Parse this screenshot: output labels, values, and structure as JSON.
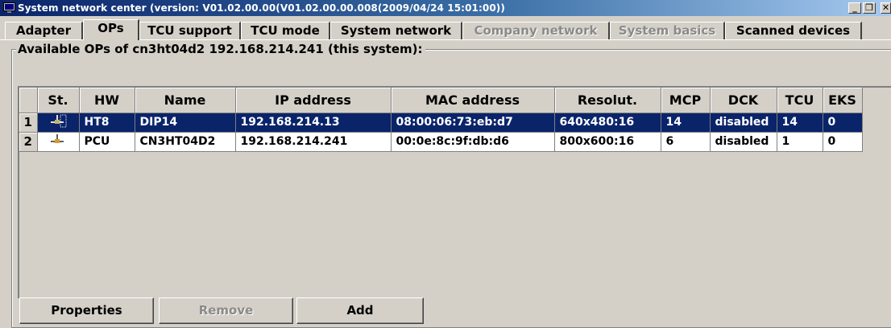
{
  "window": {
    "title": "System network center (version: V01.02.00.00(V01.02.00.00.008(2009/04/24 15:01:00))",
    "minimize_label": "_",
    "restore_label": "❒",
    "close_label": "✕"
  },
  "tabs": [
    {
      "label": "Adapter",
      "state": "normal"
    },
    {
      "label": "OPs",
      "state": "active"
    },
    {
      "label": "TCU support",
      "state": "normal"
    },
    {
      "label": "TCU mode",
      "state": "normal"
    },
    {
      "label": "System network",
      "state": "normal"
    },
    {
      "label": "Company network",
      "state": "disabled"
    },
    {
      "label": "System basics",
      "state": "disabled"
    },
    {
      "label": "Scanned devices",
      "state": "normal"
    }
  ],
  "group": {
    "title": "Available OPs of cn3ht04d2 192.168.214.241 (this system):"
  },
  "table": {
    "columns": [
      "St.",
      "HW",
      "Name",
      "IP address",
      "MAC address",
      "Resolut.",
      "MCP",
      "DCK",
      "TCU",
      "EKS"
    ],
    "rows": [
      {
        "num": "1",
        "status_icon": "network-node-icon",
        "selected": true,
        "cells": [
          "HT8",
          "DIP14",
          "192.168.214.13",
          "08:00:06:73:eb:d7",
          "640x480:16",
          "14",
          "disabled",
          "14",
          "0"
        ]
      },
      {
        "num": "2",
        "status_icon": "network-node-icon",
        "selected": false,
        "cells": [
          "PCU",
          "CN3HT04D2",
          "192.168.214.241",
          "00:0e:8c:9f:db:d6",
          "800x600:16",
          "6",
          "disabled",
          "1",
          "0"
        ]
      }
    ]
  },
  "buttons": {
    "properties": "Properties",
    "remove": "Remove",
    "add": "Add"
  },
  "colors": {
    "selection": "#0a246a",
    "titlebar_start": "#0a246a",
    "face": "#d4d0c8"
  }
}
